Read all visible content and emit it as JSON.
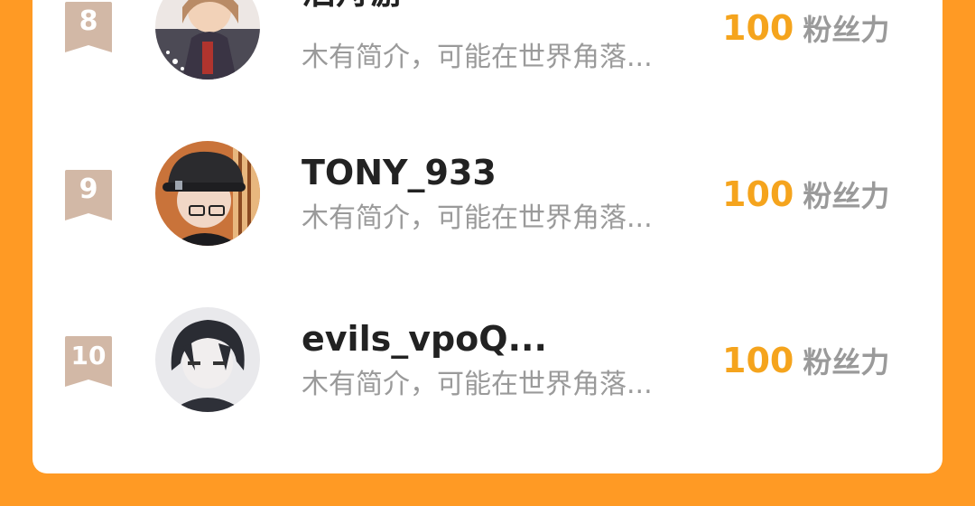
{
  "ranking": {
    "items": [
      {
        "rank": "8",
        "username": "泊舟游",
        "bio": "木有简介，可能在世界角落...",
        "fans_value": "100",
        "fans_label": "粉丝力"
      },
      {
        "rank": "9",
        "username": "TONY_933",
        "bio": "木有简介，可能在世界角落...",
        "fans_value": "100",
        "fans_label": "粉丝力"
      },
      {
        "rank": "10",
        "username": "evils_vpoQ...",
        "bio": "木有简介，可能在世界角落...",
        "fans_value": "100",
        "fans_label": "粉丝力"
      }
    ]
  },
  "colors": {
    "page_background": "#FF9A24",
    "card_background": "#FFFFFF",
    "rank_badge": "#D2B8A6",
    "fans_value": "#F5A41D",
    "secondary_text": "#9A9A9A",
    "primary_text": "#222222"
  },
  "icons": {
    "rank_badge": "ribbon-bookmark-icon"
  }
}
